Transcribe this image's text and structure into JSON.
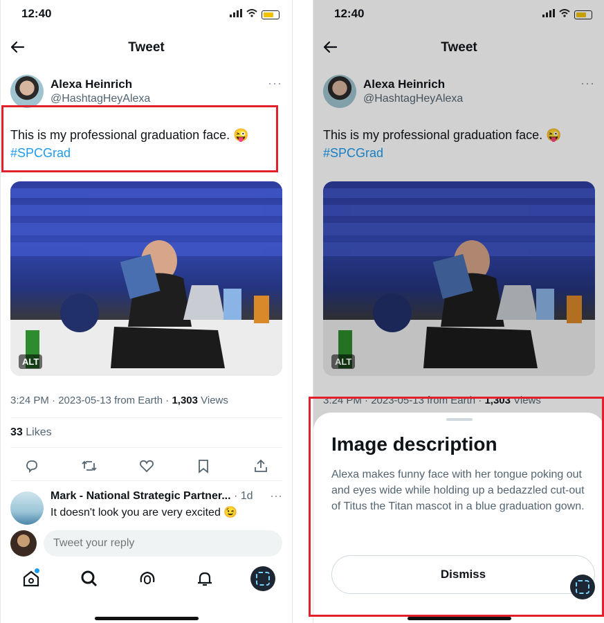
{
  "status": {
    "time": "12:40"
  },
  "header": {
    "title": "Tweet"
  },
  "tweet": {
    "author_name": "Alexa Heinrich",
    "author_handle": "@HashtagHeyAlexa",
    "text": "This is my professional graduation face. 😜",
    "hashtag": "#SPCGrad",
    "alt_badge": "ALT",
    "meta_time": "3:24 PM · 2023-05-13 from Earth · ",
    "views_count": "1,303",
    "views_label": " Views",
    "likes_count": "33",
    "likes_label": " Likes"
  },
  "actions": [
    "reply-icon",
    "retweet-icon",
    "like-icon",
    "bookmark-icon",
    "share-icon"
  ],
  "reply": {
    "name": "Mark - National Strategic Partner...",
    "time": " · 1d",
    "text": "It doesn't look you are very excited 😉"
  },
  "compose": {
    "placeholder": "Tweet your reply"
  },
  "tabbar": [
    "home-icon",
    "search-icon",
    "spaces-icon",
    "notifications-icon",
    "profile-avatar"
  ],
  "sheet": {
    "title": "Image description",
    "description": "Alexa makes funny face with her tongue poking out and eyes wide while holding up a bedazzled cut-out of Titus the Titan mascot in a blue graduation gown.",
    "dismiss_label": "Dismiss"
  },
  "colors": {
    "accent": "#1d9bf0",
    "highlight": "#e0202a"
  }
}
